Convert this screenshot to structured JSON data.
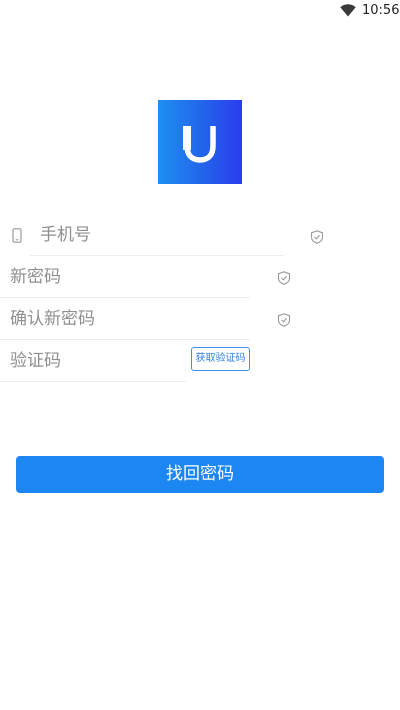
{
  "status_bar": {
    "time": "10:56",
    "wifi_icon": "wifi-icon"
  },
  "logo": {
    "icon": "u-logo-icon",
    "gradient_start": "#1e8ff0",
    "gradient_end": "#2a3cf0"
  },
  "form": {
    "phone": {
      "placeholder": "手机号",
      "value": "",
      "icon": "phone-icon"
    },
    "new_password": {
      "placeholder": "新密码",
      "value": ""
    },
    "confirm_password": {
      "placeholder": "确认新密码",
      "value": ""
    },
    "verification_code": {
      "placeholder": "验证码",
      "value": ""
    },
    "get_code_label": "获取验证码",
    "submit_label": "找回密码"
  },
  "colors": {
    "accent": "#1c86f3",
    "underline": "#ececec",
    "placeholder": "#8f8f8f"
  }
}
